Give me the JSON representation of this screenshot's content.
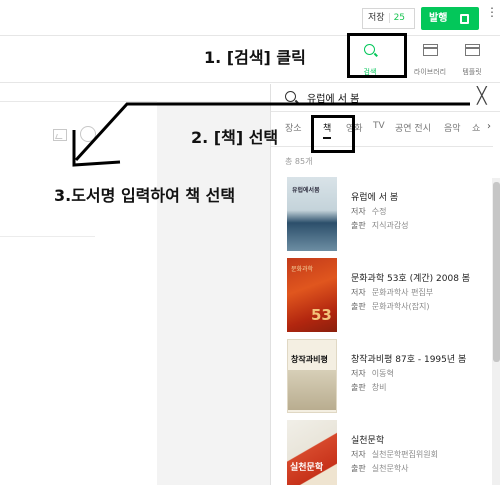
{
  "header": {
    "save_label": "저장",
    "save_count": "25",
    "publish_label": "발행",
    "more_label": "⋮"
  },
  "tools": [
    {
      "name": "search",
      "label": "검색"
    },
    {
      "name": "library",
      "label": "라이브러리"
    },
    {
      "name": "template",
      "label": "템플릿"
    }
  ],
  "search_panel": {
    "query": "유럽에 서 봄",
    "close_label": "╳",
    "tabs": [
      "장소",
      "책",
      "영화",
      "TV",
      "공연 전시",
      "음악",
      "쇼"
    ],
    "active_tab": "책",
    "result_count": "총 85개",
    "more_tabs_label": "›",
    "results": [
      {
        "title": "유럽에 서 봄",
        "author_key": "저자",
        "author": "수정",
        "pub_key": "출판",
        "publisher": "지식과감성",
        "cover_text": "유럽에서봄"
      },
      {
        "title": "문화과학 53호 (계간) 2008 봄",
        "author_key": "저자",
        "author": "문화과학사 편집부",
        "pub_key": "출판",
        "publisher": "문화과학사(잡지)",
        "cover_text": "문화과학",
        "cover_num": "53"
      },
      {
        "title": "창작과비평 87호 - 1995년 봄",
        "author_key": "저자",
        "author": "이동혁",
        "pub_key": "출판",
        "publisher": "창비",
        "cover_text": "창작과비평"
      },
      {
        "title": "실천문학",
        "author_key": "저자",
        "author": "실천문학편집위원회",
        "pub_key": "출판",
        "publisher": "실천문학사",
        "cover_text": "실천문학"
      }
    ]
  },
  "annotations": {
    "step1": "1. [검색] 클릭",
    "step2": "2. [책] 선택",
    "step3": "3.도서명 입력하여 책 선택"
  },
  "colors": {
    "accent_green": "#03c75a",
    "annotation": "#000000"
  }
}
